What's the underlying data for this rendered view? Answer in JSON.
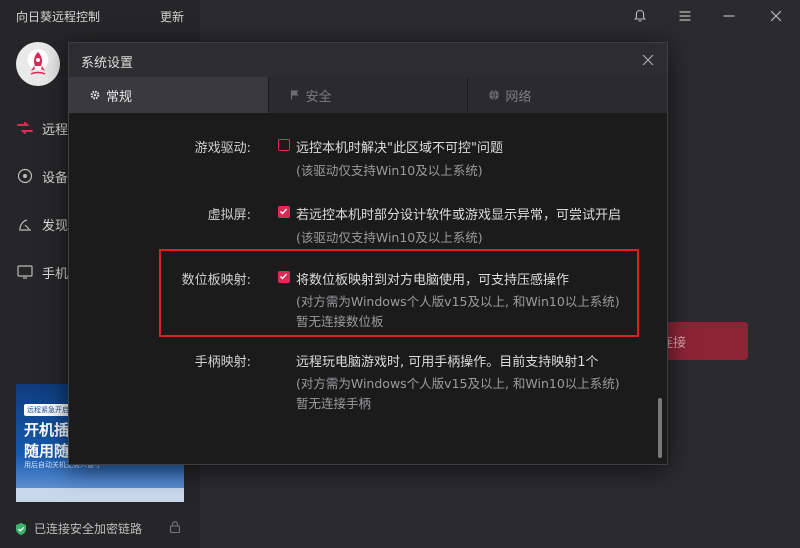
{
  "app": {
    "title": "向日葵远程控制",
    "update_label": "更新"
  },
  "sidebar": {
    "items": [
      {
        "label": "远程",
        "icon": "remote-icon"
      },
      {
        "label": "设备",
        "icon": "device-icon"
      },
      {
        "label": "发现",
        "icon": "discover-icon"
      },
      {
        "label": "手机",
        "icon": "phone-icon"
      }
    ],
    "promo": {
      "tag": "远程紧急开启必备",
      "line1": "开机插座",
      "line2": "随用随开",
      "sub": "用后自动关机无需人值守"
    },
    "status": "已连接安全加密链路"
  },
  "main": {
    "connect_label": "连接"
  },
  "colors": {
    "accent": "#d92b55",
    "highlight": "#e02020",
    "connect_button": "#8d2436"
  },
  "modal": {
    "title": "系统设置",
    "tabs": [
      {
        "label": "常规",
        "icon": "gear-icon",
        "active": true
      },
      {
        "label": "安全",
        "icon": "flag-icon",
        "active": false
      },
      {
        "label": "网络",
        "icon": "globe-icon",
        "active": false
      }
    ],
    "settings": [
      {
        "label": "游戏驱动:",
        "checked": false,
        "text": "远控本机时解决\"此区域不可控\"问题",
        "notes": [
          "(该驱动仅支持Win10及以上系统)"
        ]
      },
      {
        "label": "虚拟屏:",
        "checked": true,
        "text": "若远控本机时部分设计软件或游戏显示异常，可尝试开启",
        "notes": [
          "(该驱动仅支持Win10及以上系统)"
        ]
      },
      {
        "label": "数位板映射:",
        "checked": true,
        "text": "将数位板映射到对方电脑使用，可支持压感操作",
        "notes": [
          "(对方需为Windows个人版v15及以上, 和Win10以上系统)",
          "暂无连接数位板"
        ]
      },
      {
        "label": "手柄映射:",
        "text": "远程玩电脑游戏时, 可用手柄操作。目前支持映射1个",
        "notes": [
          "(对方需为Windows个人版v15及以上, 和Win10以上系统)",
          "暂无连接手柄"
        ]
      }
    ]
  }
}
